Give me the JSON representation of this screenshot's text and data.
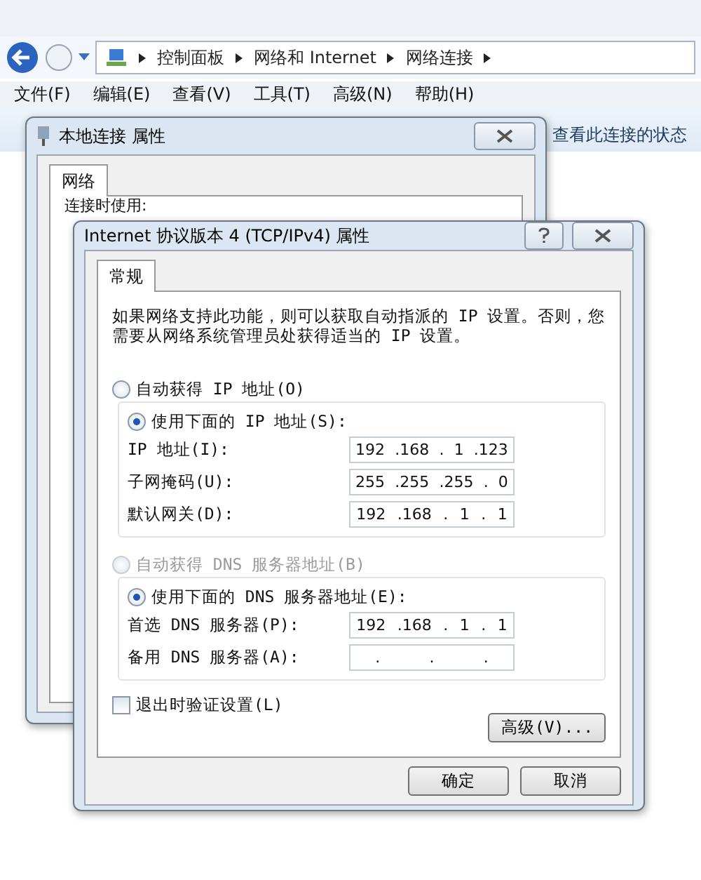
{
  "explorer": {
    "breadcrumbs": [
      "控制面板",
      "网络和 Internet",
      "网络连接"
    ],
    "menu": [
      "文件(F)",
      "编辑(E)",
      "查看(V)",
      "工具(T)",
      "高级(N)",
      "帮助(H)"
    ],
    "toolbar_link": "查看此连接的状态"
  },
  "back_dialog": {
    "title": "本地连接 属性",
    "tabs": [
      {
        "label": "网络",
        "selected": true
      }
    ],
    "label": "连接时使用:"
  },
  "dialog": {
    "title": "Internet 协议版本 4 (TCP/IPv4) 属性",
    "tabs": [
      {
        "label": "常规",
        "selected": true
      }
    ],
    "description": "如果网络支持此功能，则可以获取自动指派的 IP 设置。否则，您需要从网络系统管理员处获得适当的 IP 设置。",
    "ip_options": [
      {
        "label": "自动获得 IP 地址(O)",
        "selected": false,
        "disabled": false
      },
      {
        "label": "使用下面的 IP 地址(S):",
        "selected": true,
        "disabled": false
      }
    ],
    "ip_fields": [
      {
        "label": "IP 地址(I):",
        "parts": [
          "192",
          ".168",
          ".",
          "1",
          ".123"
        ]
      },
      {
        "label": "子网掩码(U):",
        "parts": [
          "255",
          ".255",
          ".255",
          ".",
          "0"
        ]
      },
      {
        "label": "默认网关(D):",
        "parts": [
          "192",
          ".168",
          ".",
          "1",
          ".",
          "1"
        ]
      }
    ],
    "dns_options": [
      {
        "label": "自动获得 DNS 服务器地址(B)",
        "selected": false,
        "disabled": true
      },
      {
        "label": "使用下面的 DNS 服务器地址(E):",
        "selected": true,
        "disabled": false
      }
    ],
    "dns_fields": [
      {
        "label": "首选 DNS 服务器(P):",
        "parts": [
          "192",
          ".168",
          ".",
          "1",
          ".",
          "1"
        ]
      },
      {
        "label": "备用 DNS 服务器(A):",
        "parts": [
          ".",
          ".",
          "."
        ]
      }
    ],
    "validate": {
      "label": "退出时验证设置(L)",
      "checked": false
    },
    "advanced_button": "高级(V)...",
    "buttons": [
      "确定",
      "取消"
    ]
  }
}
